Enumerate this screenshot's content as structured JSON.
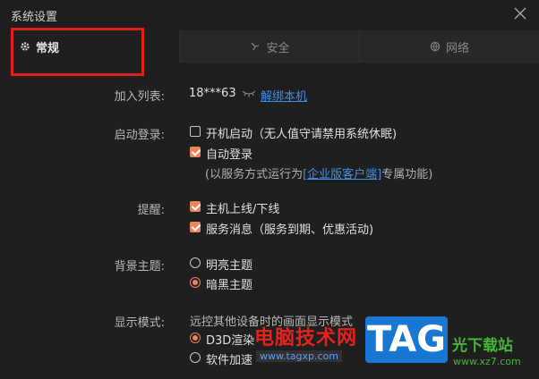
{
  "window": {
    "title": "系统设置"
  },
  "tabs": [
    {
      "label": "常规",
      "icon": "gear-icon",
      "active": true
    },
    {
      "label": "安全",
      "icon": "shield-icon",
      "active": false
    },
    {
      "label": "网络",
      "icon": "globe-icon",
      "active": false
    }
  ],
  "join_list": {
    "label": "加入列表:",
    "account": "18***63",
    "unbind_link": "解绑本机"
  },
  "startup": {
    "label": "启动登录:",
    "boot_start": {
      "text": "开机启动（无人值守请禁用系统休眠)",
      "checked": false
    },
    "auto_login": {
      "text": "自动登录",
      "checked": true
    },
    "service_note_prefix": "(以服务方式运行为",
    "service_note_link": "[企业版客户端]",
    "service_note_suffix": "专属功能)"
  },
  "reminder": {
    "label": "提醒:",
    "host_online": {
      "text": "主机上线/下线",
      "checked": true
    },
    "service_msg": {
      "text": "服务消息（服务到期、优惠活动)",
      "checked": true
    }
  },
  "theme": {
    "label": "背景主题:",
    "light": {
      "text": "明亮主题",
      "selected": false
    },
    "dark": {
      "text": "暗黑主题",
      "selected": true
    }
  },
  "display_mode": {
    "label": "显示模式:",
    "description": "远控其他设备时的画面显示模式",
    "d3d": {
      "text": "D3D渲染",
      "selected": true
    },
    "software": {
      "text": "软件加速",
      "selected": false
    }
  },
  "watermark": {
    "red_text": "电脑技术网",
    "url": "www.tagxp.com",
    "tag": "TAG",
    "cn": "光下载站",
    "url2": "www.xz7.com"
  },
  "colors": {
    "accent": "#f0835a",
    "link": "#3f8fe6",
    "highlight": "#e0201b",
    "background": "#1f1f1f"
  }
}
